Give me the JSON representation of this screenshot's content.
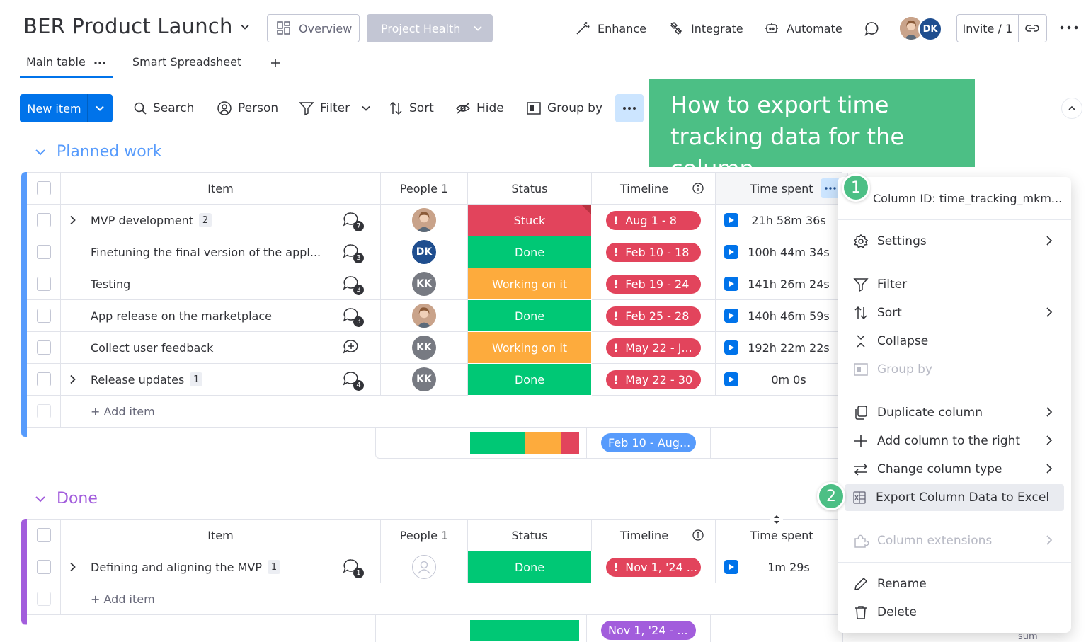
{
  "header": {
    "board_title": "BER Product Launch",
    "overview_label": "Overview",
    "project_health_label": "Project Health",
    "enhance_label": "Enhance",
    "integrate_label": "Integrate",
    "automate_label": "Automate",
    "avatar_initials": "DK",
    "invite_label": "Invite / 1"
  },
  "tabs": [
    {
      "label": "Main table"
    },
    {
      "label": "Smart Spreadsheet"
    }
  ],
  "toolbar": {
    "new_item_label": "New item",
    "search_label": "Search",
    "person_label": "Person",
    "filter_label": "Filter",
    "sort_label": "Sort",
    "hide_label": "Hide",
    "group_by_label": "Group by"
  },
  "callout": {
    "text": "How to export time tracking data for the column"
  },
  "columns": {
    "item": "Item",
    "people": "People 1",
    "status": "Status",
    "timeline": "Timeline",
    "time_spent": "Time spent"
  },
  "groups": [
    {
      "title": "Planned work",
      "color": "#579bfc",
      "rows": [
        {
          "name": "MVP development",
          "subitems": "2",
          "updates": "7",
          "person": "photo",
          "status": "Stuck",
          "status_color": "#e2445c",
          "timeline": "Aug 1 - 8",
          "time": "21h 58m 36s"
        },
        {
          "name": "Finetuning the final version of the appl...",
          "subitems": "",
          "updates": "3",
          "person": "DK",
          "status": "Done",
          "status_color": "#00c875",
          "timeline": "Feb 10 - 18",
          "time": "100h 44m 34s"
        },
        {
          "name": "Testing",
          "subitems": "",
          "updates": "3",
          "person": "KK",
          "status": "Working on it",
          "status_color": "#fdab3d",
          "timeline": "Feb 19 - 24",
          "time": "141h 26m 24s"
        },
        {
          "name": "App release on the marketplace",
          "subitems": "",
          "updates": "3",
          "person": "photo",
          "status": "Done",
          "status_color": "#00c875",
          "timeline": "Feb 25 - 28",
          "time": "140h 46m 59s"
        },
        {
          "name": "Collect user feedback",
          "subitems": "",
          "updates": "",
          "person": "KK",
          "status": "Working on it",
          "status_color": "#fdab3d",
          "timeline": "May 22 - J...",
          "time": "192h 22m 22s"
        },
        {
          "name": "Release updates",
          "subitems": "1",
          "updates": "4",
          "person": "KK",
          "status": "Done",
          "status_color": "#00c875",
          "timeline": "May 22 - 30",
          "time": "0m 0s"
        }
      ],
      "add_item_label": "+ Add item",
      "summary_timeline": "Feb 10 - Aug...",
      "status_summary": [
        {
          "color": "#00c875",
          "fraction": 0.5
        },
        {
          "color": "#fdab3d",
          "fraction": 0.33
        },
        {
          "color": "#e2445c",
          "fraction": 0.17
        }
      ]
    },
    {
      "title": "Done",
      "color": "#a25ddc",
      "rows": [
        {
          "name": "Defining and aligning the MVP",
          "subitems": "1",
          "updates": "1",
          "person": "empty",
          "status": "Done",
          "status_color": "#00c875",
          "timeline": "Nov 1, '24 ...",
          "time": "1m 29s"
        }
      ],
      "add_item_label": "+ Add item",
      "summary_timeline": "Nov 1, '24 - ...",
      "summary_footer": "sum"
    }
  ],
  "menu": {
    "column_id": "Column ID: time_tracking_mkm...",
    "settings": "Settings",
    "filter": "Filter",
    "sort": "Sort",
    "collapse": "Collapse",
    "group_by": "Group by",
    "duplicate": "Duplicate column",
    "add_right": "Add column to the right",
    "change_type": "Change column type",
    "export": "Export Column Data to Excel",
    "extensions": "Column extensions",
    "rename": "Rename",
    "delete": "Delete"
  },
  "steps": [
    "1",
    "2"
  ],
  "colors": {
    "primary": "#0073ea",
    "callout": "#4cbf85",
    "stuck": "#e2445c",
    "done": "#00c875",
    "working": "#fdab3d"
  }
}
